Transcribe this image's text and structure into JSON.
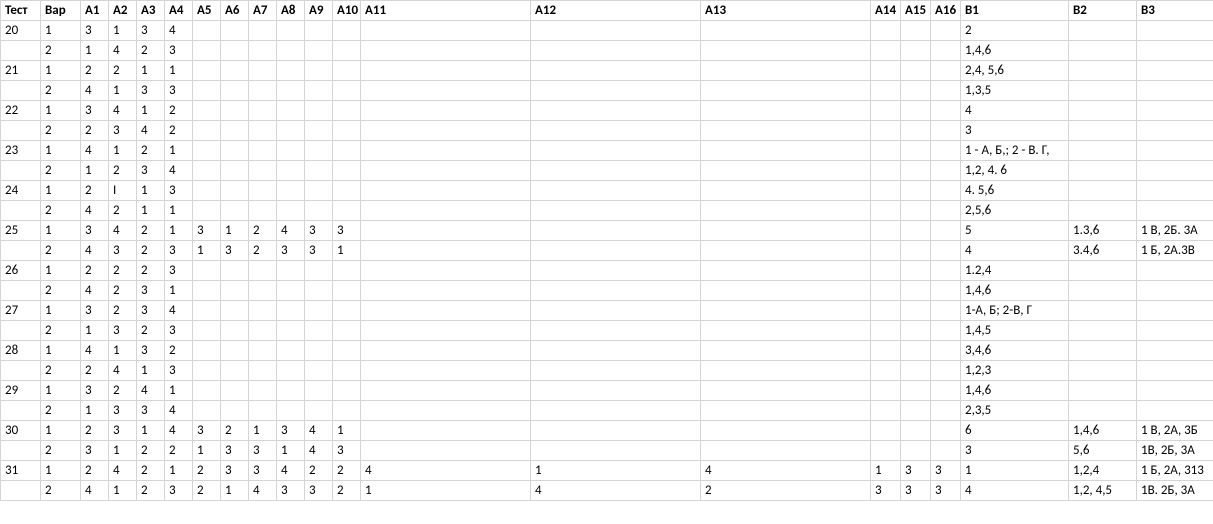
{
  "headers": [
    "Тест",
    "Вар",
    "А1",
    "А2",
    "А3",
    "А4",
    "А5",
    "А6",
    "А7",
    "А8",
    "А9",
    "А10",
    "А11",
    "А12",
    "А13",
    "А14",
    "А15",
    "А16",
    "В1",
    "В2",
    "В3"
  ],
  "rows": [
    {
      "Тест": "20",
      "Вар": "1",
      "А1": "3",
      "А2": "1",
      "А3": "3",
      "А4": "4",
      "А5": "",
      "А6": "",
      "А7": "",
      "А8": "",
      "А9": "",
      "А10": "",
      "А11": "",
      "А12": "",
      "А13": "",
      "А14": "",
      "А15": "",
      "А16": "",
      "В1": "2",
      "В2": "",
      "В3": ""
    },
    {
      "Тест": "",
      "Вар": "2",
      "А1": "1",
      "А2": "4",
      "А3": "2",
      "А4": "3",
      "А5": "",
      "А6": "",
      "А7": "",
      "А8": "",
      "А9": "",
      "А10": "",
      "А11": "",
      "А12": "",
      "А13": "",
      "А14": "",
      "А15": "",
      "А16": "",
      "В1": "1,4,6",
      "В2": "",
      "В3": ""
    },
    {
      "Тест": "21",
      "Вар": "1",
      "А1": "2",
      "А2": "2",
      "А3": "1",
      "А4": "1",
      "А5": "",
      "А6": "",
      "А7": "",
      "А8": "",
      "А9": "",
      "А10": "",
      "А11": "",
      "А12": "",
      "А13": "",
      "А14": "",
      "А15": "",
      "А16": "",
      "В1": "2,4, 5,6",
      "В2": "",
      "В3": ""
    },
    {
      "Тест": "",
      "Вар": "2",
      "А1": "4",
      "А2": "1",
      "А3": "3",
      "А4": "3",
      "А5": "",
      "А6": "",
      "А7": "",
      "А8": "",
      "А9": "",
      "А10": "",
      "А11": "",
      "А12": "",
      "А13": "",
      "А14": "",
      "А15": "",
      "А16": "",
      "В1": "1,3,5",
      "В2": "",
      "В3": ""
    },
    {
      "Тест": "22",
      "Вар": "1",
      "А1": "3",
      "А2": "4",
      "А3": "1",
      "А4": "2",
      "А5": "",
      "А6": "",
      "А7": "",
      "А8": "",
      "А9": "",
      "А10": "",
      "А11": "",
      "А12": "",
      "А13": "",
      "А14": "",
      "А15": "",
      "А16": "",
      "В1": "4",
      "В2": "",
      "В3": ""
    },
    {
      "Тест": "",
      "Вар": "2",
      "А1": "2",
      "А2": "3",
      "А3": "4",
      "А4": "2",
      "А5": "",
      "А6": "",
      "А7": "",
      "А8": "",
      "А9": "",
      "А10": "",
      "А11": "",
      "А12": "",
      "А13": "",
      "А14": "",
      "А15": "",
      "А16": "",
      "В1": "3",
      "В2": "",
      "В3": ""
    },
    {
      "Тест": "23",
      "Вар": "1",
      "А1": "4",
      "А2": "1",
      "А3": "2",
      "А4": "1",
      "А5": "",
      "А6": "",
      "А7": "",
      "А8": "",
      "А9": "",
      "А10": "",
      "А11": "",
      "А12": "",
      "А13": "",
      "А14": "",
      "А15": "",
      "А16": "",
      "В1": "1 - А, Б,; 2  - В. Г,",
      "В2": "",
      "В3": ""
    },
    {
      "Тест": "",
      "Вар": "2",
      "А1": "1",
      "А2": "2",
      "А3": "3",
      "А4": "4",
      "А5": "",
      "А6": "",
      "А7": "",
      "А8": "",
      "А9": "",
      "А10": "",
      "А11": "",
      "А12": "",
      "А13": "",
      "А14": "",
      "А15": "",
      "А16": "",
      "В1": "1,2, 4. 6",
      "В2": "",
      "В3": ""
    },
    {
      "Тест": "24",
      "Вар": "1",
      "А1": "2",
      "А2": "I",
      "А3": "1",
      "А4": "3",
      "А5": "",
      "А6": "",
      "А7": "",
      "А8": "",
      "А9": "",
      "А10": "",
      "А11": "",
      "А12": "",
      "А13": "",
      "А14": "",
      "А15": "",
      "А16": "",
      "В1": "4. 5,6",
      "В2": "",
      "В3": ""
    },
    {
      "Тест": "",
      "Вар": "2",
      "А1": "4",
      "А2": "2",
      "А3": "1",
      "А4": "1",
      "А5": "",
      "А6": "",
      "А7": "",
      "А8": "",
      "А9": "",
      "А10": "",
      "А11": "",
      "А12": "",
      "А13": "",
      "А14": "",
      "А15": "",
      "А16": "",
      "В1": "2,5,6",
      "В2": "",
      "В3": ""
    },
    {
      "Тест": "25",
      "Вар": "1",
      "А1": "3",
      "А2": "4",
      "А3": "2",
      "А4": "1",
      "А5": "3",
      "А6": "1",
      "А7": "2",
      "А8": "4",
      "А9": "3",
      "А10": "3",
      "А11": "",
      "А12": "",
      "А13": "",
      "А14": "",
      "А15": "",
      "А16": "",
      "В1": "5",
      "В2": "1.3,6",
      "В3": "1 В, 2Б. 3А"
    },
    {
      "Тест": "",
      "Вар": "2",
      "А1": "4",
      "А2": "3",
      "А3": "2",
      "А4": "3",
      "А5": "1",
      "А6": "3",
      "А7": "2",
      "А8": "3",
      "А9": "3",
      "А10": "1",
      "А11": "",
      "А12": "",
      "А13": "",
      "А14": "",
      "А15": "",
      "А16": "",
      "В1": "4",
      "В2": "3.4,6",
      "В3": "1 Б, 2А.3В"
    },
    {
      "Тест": "26",
      "Вар": "1",
      "А1": "2",
      "А2": "2",
      "А3": "2",
      "А4": "3",
      "А5": "",
      "А6": "",
      "А7": "",
      "А8": "",
      "А9": "",
      "А10": "",
      "А11": "",
      "А12": "",
      "А13": "",
      "А14": "",
      "А15": "",
      "А16": "",
      "В1": "1.2,4",
      "В2": "",
      "В3": ""
    },
    {
      "Тест": "",
      "Вар": "2",
      "А1": "4",
      "А2": "2",
      "А3": "3",
      "А4": "1",
      "А5": "",
      "А6": "",
      "А7": "",
      "А8": "",
      "А9": "",
      "А10": "",
      "А11": "",
      "А12": "",
      "А13": "",
      "А14": "",
      "А15": "",
      "А16": "",
      "В1": "1,4,6",
      "В2": "",
      "В3": ""
    },
    {
      "Тест": "27",
      "Вар": "1",
      "А1": "3",
      "А2": "2",
      "А3": "3",
      "А4": "4",
      "А5": "",
      "А6": "",
      "А7": "",
      "А8": "",
      "А9": "",
      "А10": "",
      "А11": "",
      "А12": "",
      "А13": "",
      "А14": "",
      "А15": "",
      "А16": "",
      "В1": "1-А, Б; 2-В, Г",
      "В2": "",
      "В3": ""
    },
    {
      "Тест": "",
      "Вар": "2",
      "А1": "1",
      "А2": "3",
      "А3": "2",
      "А4": "3",
      "А5": "",
      "А6": "",
      "А7": "",
      "А8": "",
      "А9": "",
      "А10": "",
      "А11": "",
      "А12": "",
      "А13": "",
      "А14": "",
      "А15": "",
      "А16": "",
      "В1": "1,4,5",
      "В2": "",
      "В3": ""
    },
    {
      "Тест": "28",
      "Вар": "1",
      "А1": "4",
      "А2": "1",
      "А3": "3",
      "А4": "2",
      "А5": "",
      "А6": "",
      "А7": "",
      "А8": "",
      "А9": "",
      "А10": "",
      "А11": "",
      "А12": "",
      "А13": "",
      "А14": "",
      "А15": "",
      "А16": "",
      "В1": "3,4,6",
      "В2": "",
      "В3": ""
    },
    {
      "Тест": "",
      "Вар": "2",
      "А1": "2",
      "А2": "4",
      "А3": "1",
      "А4": "3",
      "А5": "",
      "А6": "",
      "А7": "",
      "А8": "",
      "А9": "",
      "А10": "",
      "А11": "",
      "А12": "",
      "А13": "",
      "А14": "",
      "А15": "",
      "А16": "",
      "В1": "1,2,3",
      "В2": "",
      "В3": ""
    },
    {
      "Тест": "29",
      "Вар": "1",
      "А1": "3",
      "А2": "2",
      "А3": "4",
      "А4": "1",
      "А5": "",
      "А6": "",
      "А7": "",
      "А8": "",
      "А9": "",
      "А10": "",
      "А11": "",
      "А12": "",
      "А13": "",
      "А14": "",
      "А15": "",
      "А16": "",
      "В1": "1,4,6",
      "В2": "",
      "В3": ""
    },
    {
      "Тест": "",
      "Вар": "2",
      "А1": "1",
      "А2": "3",
      "А3": "3",
      "А4": "4",
      "А5": "",
      "А6": "",
      "А7": "",
      "А8": "",
      "А9": "",
      "А10": "",
      "А11": "",
      "А12": "",
      "А13": "",
      "А14": "",
      "А15": "",
      "А16": "",
      "В1": "2,3,5",
      "В2": "",
      "В3": ""
    },
    {
      "Тест": "30",
      "Вар": "1",
      "А1": "2",
      "А2": "3",
      "А3": "1",
      "А4": "4",
      "А5": "3",
      "А6": "2",
      "А7": "1",
      "А8": "3",
      "А9": "4",
      "А10": "1",
      "А11": "",
      "А12": "",
      "А13": "",
      "А14": "",
      "А15": "",
      "А16": "",
      "В1": "6",
      "В2": "1,4,6",
      "В3": "1 В, 2А, 3Б"
    },
    {
      "Тест": "",
      "Вар": "2",
      "А1": "3",
      "А2": "1",
      "А3": "2",
      "А4": "2",
      "А5": "1",
      "А6": "3",
      "А7": "3",
      "А8": "1",
      "А9": "4",
      "А10": "3",
      "А11": "",
      "А12": "",
      "А13": "",
      "А14": "",
      "А15": "",
      "А16": "",
      "В1": "3",
      "В2": "5,6",
      "В3": "1В, 2Б, 3А"
    },
    {
      "Тест": "31",
      "Вар": "1",
      "А1": "2",
      "А2": "4",
      "А3": "2",
      "А4": "1",
      "А5": "2",
      "А6": "3",
      "А7": "3",
      "А8": "4",
      "А9": "2",
      "А10": "2",
      "А11": "4",
      "А12": "1",
      "А13": "4",
      "А14": "1",
      "А15": "3",
      "А16": "3",
      "В1": "1",
      "В2": "1,2,4",
      "В3": "1 Б, 2А, 313"
    },
    {
      "Тест": "",
      "Вар": "2",
      "А1": "4",
      "А2": "1",
      "А3": "2",
      "А4": "3",
      "А5": "2",
      "А6": "1",
      "А7": "4",
      "А8": "3",
      "А9": "3",
      "А10": "2",
      "А11": "1",
      "А12": "4",
      "А13": "2",
      "А14": "3",
      "А15": "3",
      "А16": "3",
      "В1": "4",
      "В2": "1,2, 4,5",
      "В3": "1В. 2Б, 3А"
    }
  ]
}
